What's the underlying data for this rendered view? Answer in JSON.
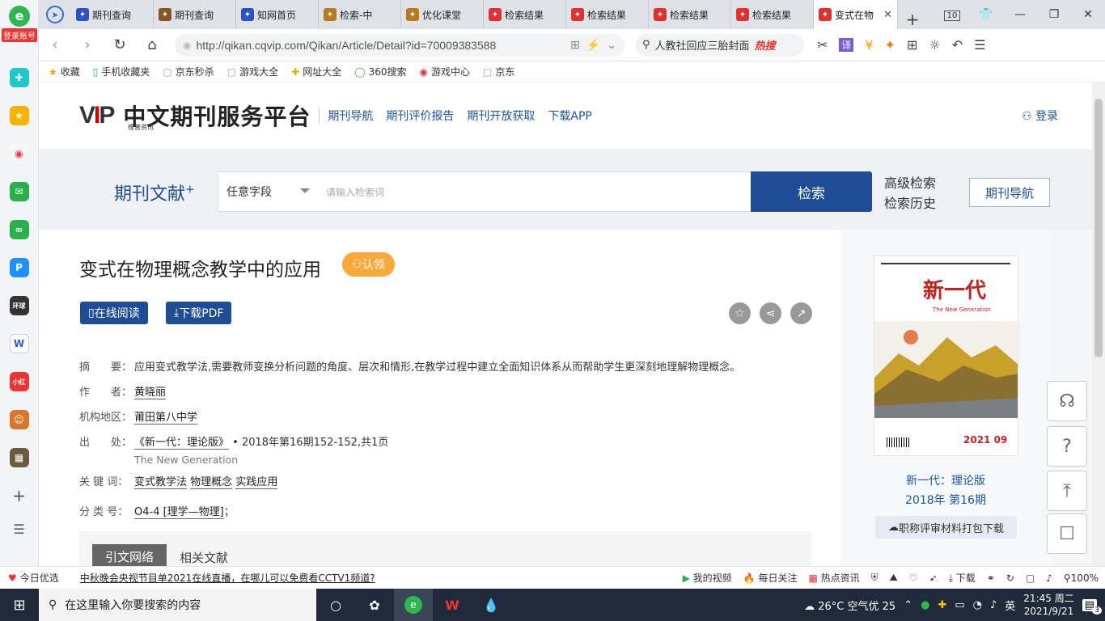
{
  "browser": {
    "tabs": [
      {
        "label": "期刊查询",
        "icon": "paw-icon",
        "color": "#3050c8"
      },
      {
        "label": "期刊查询",
        "icon": "person-icon",
        "color": "#885522"
      },
      {
        "label": "知网首页",
        "icon": "paw-icon",
        "color": "#3050c8"
      },
      {
        "label": "检索-中",
        "icon": "zhi-icon",
        "color": "#b87a1c"
      },
      {
        "label": "优化课堂",
        "icon": "zhi-icon",
        "color": "#b87a1c"
      },
      {
        "label": "检索结果",
        "icon": "wps-icon",
        "color": "#e03030"
      },
      {
        "label": "检索结果",
        "icon": "wps-icon",
        "color": "#e03030"
      },
      {
        "label": "检索结果",
        "icon": "wps-icon",
        "color": "#e03030"
      },
      {
        "label": "检索结果",
        "icon": "wps-icon",
        "color": "#e03030"
      },
      {
        "label": "变式在物",
        "icon": "wps-icon",
        "color": "#e03030"
      }
    ],
    "tab_count": "10",
    "url": "http://qikan.cqvip.com/Qikan/Article/Detail?id=70009383588",
    "search_text": "人教社回应三胎封面",
    "hot_label": "热搜"
  },
  "bookmarks": [
    {
      "label": "收藏",
      "icon": "star-icon"
    },
    {
      "label": "手机收藏夹",
      "icon": "phone-icon"
    },
    {
      "label": "京东秒杀",
      "icon": "page-icon"
    },
    {
      "label": "游戏大全",
      "icon": "page-icon"
    },
    {
      "label": "网址大全",
      "icon": "plus-globe-icon"
    },
    {
      "label": "360搜索",
      "icon": "search360-icon"
    },
    {
      "label": "游戏中心",
      "icon": "game-icon"
    },
    {
      "label": "京东",
      "icon": "page-icon"
    }
  ],
  "sidebar": {
    "login_badge": "登录账号"
  },
  "site": {
    "logo_sub": "维普资讯",
    "name": "中文期刊服务平台",
    "nav": [
      "期刊导航",
      "期刊评价报告",
      "期刊开放获取",
      "下载APP"
    ],
    "login": "登录",
    "search_title": "期刊文献",
    "field_select": "任意字段",
    "placeholder": "请输入检索词",
    "search_btn": "检索",
    "advanced": "高级检索",
    "history": "检索历史",
    "journal_nav": "期刊导航"
  },
  "article": {
    "title": "变式在物理概念教学中的应用",
    "claim": "认领",
    "read_online": "在线阅读",
    "download_pdf": "下载PDF",
    "abstract_label": "摘　　要：",
    "abstract": "应用变式教学法,需要教师变换分析问题的角度、层次和情形,在教学过程中建立全面知识体系从而帮助学生更深刻地理解物理概念。",
    "author_label": "作　　者：",
    "author": "黄晓丽",
    "org_label": "机构地区：",
    "org": "莆田第八中学",
    "source_label": "出　　处：",
    "source": "《新一代：理论版》",
    "source_detail": "• 2018年第16期152-152,共1页",
    "source_en": "The New Generation",
    "keywords_label": "关 键 词：",
    "keywords": [
      "变式教学法",
      "物理概念",
      "实践应用"
    ],
    "class_label": "分 类 号：",
    "class": "O4-4 [理学—物理]",
    "tab_cite": "引文网络",
    "tab_related": "相关文献"
  },
  "journal": {
    "cover_title": "新一代",
    "cover_en": "The New Generation",
    "cover_year": "2021 09",
    "name": "新一代：理论版",
    "issue": "2018年 第16期",
    "pack": "职称评审材料打包下载"
  },
  "statusbar": {
    "left": "今日优选",
    "news": "中秋晚会央视节目单2021在线直播，在哪儿可以免费看CCTV1频道?",
    "items": [
      "我的视频",
      "每日关注",
      "热点资讯",
      "下载"
    ],
    "zoom": "100%"
  },
  "taskbar": {
    "search": "在这里输入你要搜索的内容",
    "weather": "26°C 空气优 25",
    "ime": "英",
    "time": "21:45 周二",
    "date": "2021/9/21",
    "notif": "3"
  }
}
